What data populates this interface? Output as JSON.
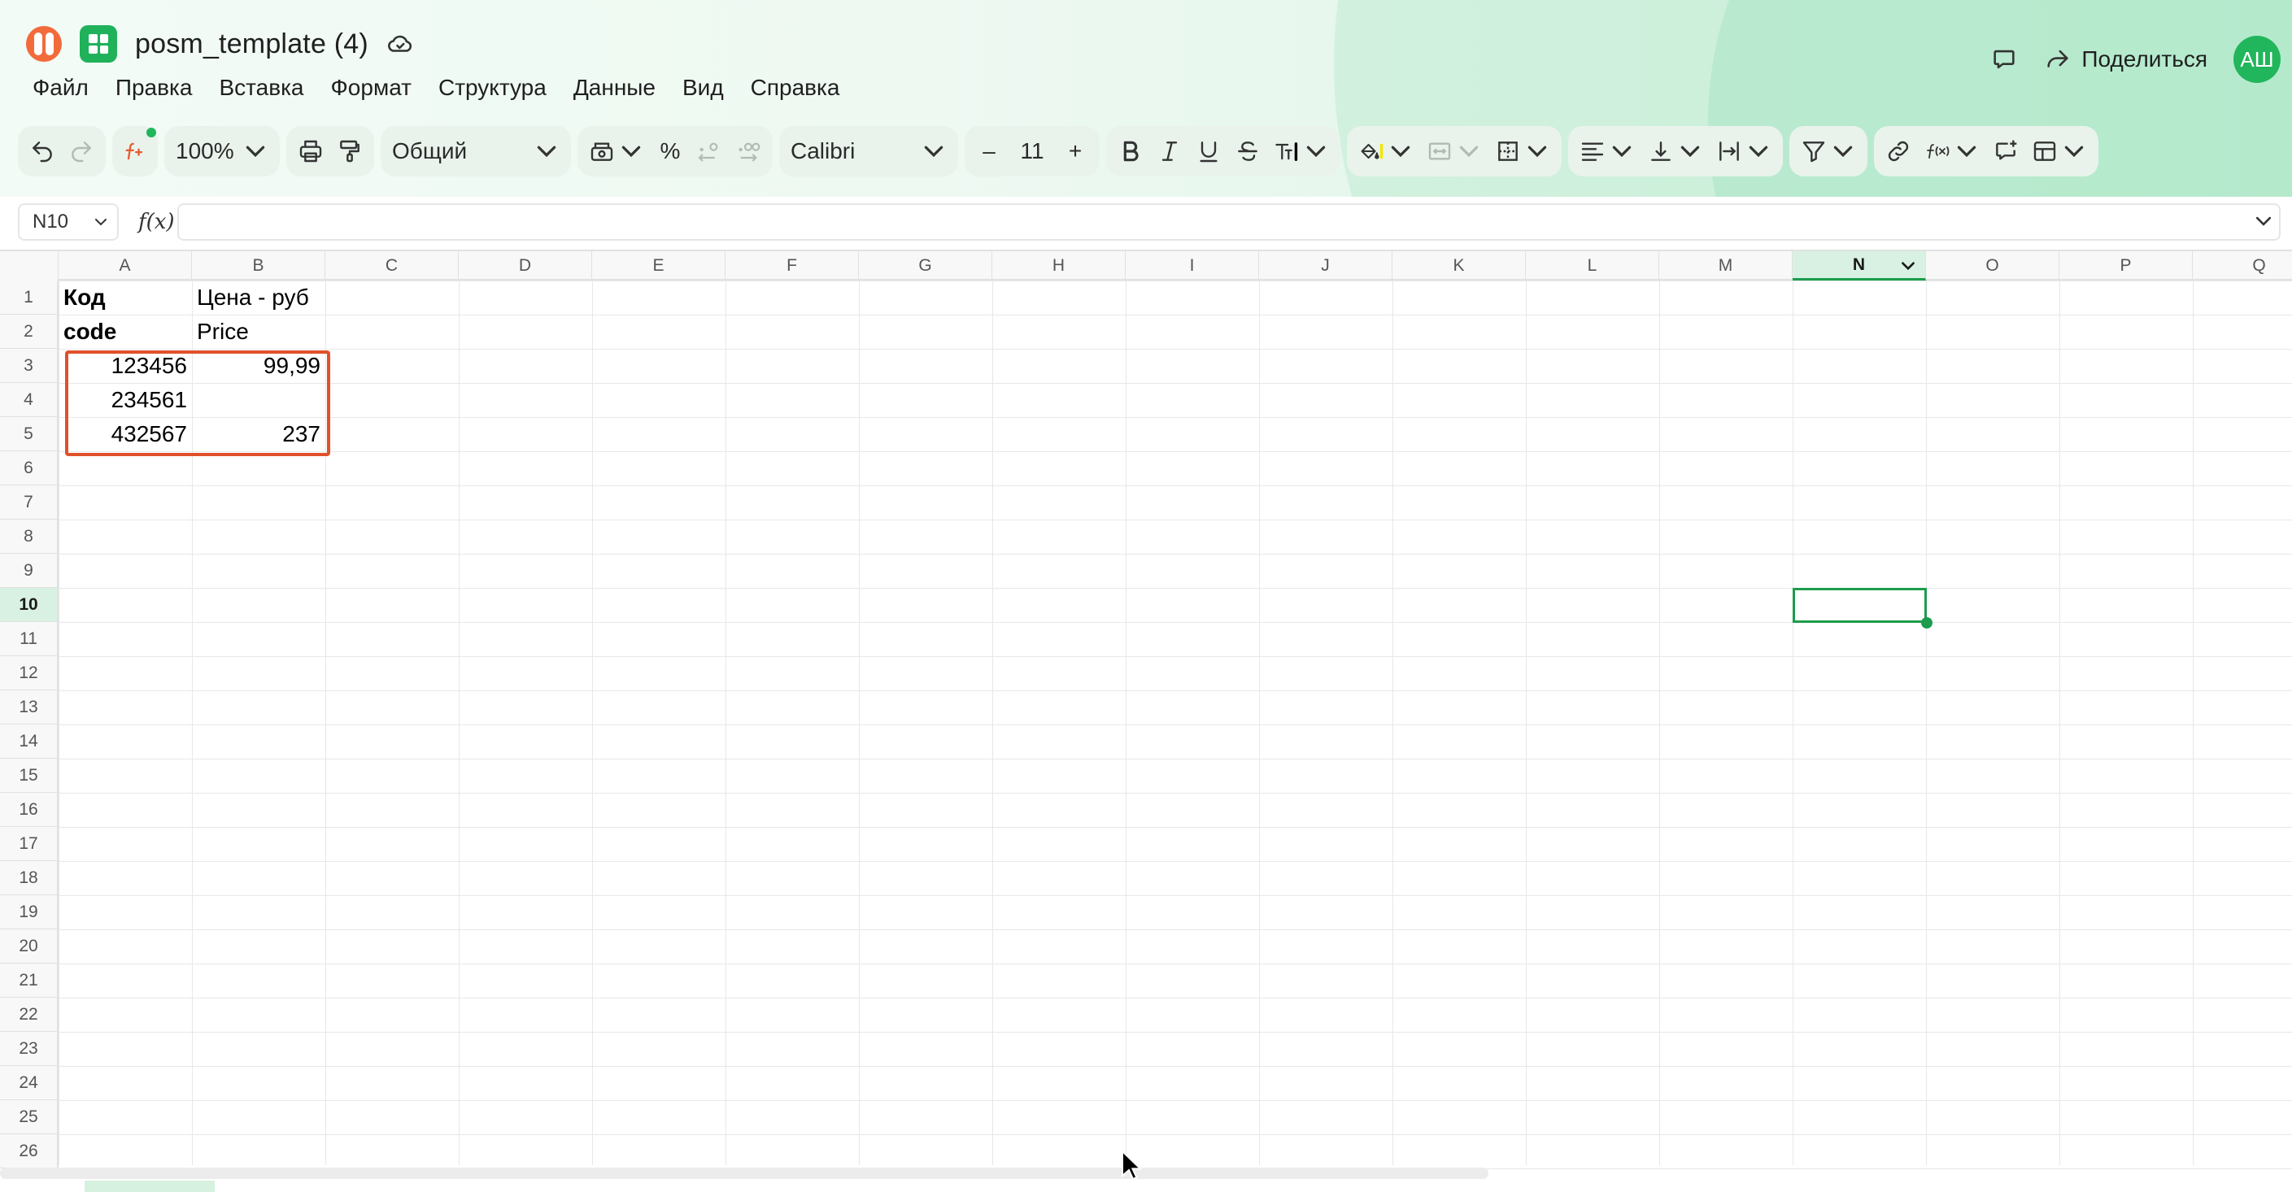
{
  "header": {
    "doc_title": "posm_template (4)",
    "share_label": "Поделиться",
    "avatar_initials": "АШ"
  },
  "menu": [
    "Файл",
    "Правка",
    "Вставка",
    "Формат",
    "Структура",
    "Данные",
    "Вид",
    "Справка"
  ],
  "toolbar": {
    "zoom": "100%",
    "number_format": "Общий",
    "font_name": "Calibri",
    "font_size": "11",
    "percent_symbol": "%",
    "minus_symbol": "–",
    "plus_symbol": "+"
  },
  "formula_bar": {
    "cell_ref": "N10",
    "fx_label": "f(x)",
    "formula": ""
  },
  "grid": {
    "columns": [
      "A",
      "B",
      "C",
      "D",
      "E",
      "F",
      "G",
      "H",
      "I",
      "J",
      "K",
      "L",
      "M",
      "N",
      "O",
      "P",
      "Q"
    ],
    "rows": [
      "1",
      "2",
      "3",
      "4",
      "5",
      "6",
      "7",
      "8",
      "9",
      "10",
      "11",
      "12",
      "13",
      "14",
      "15",
      "16",
      "17",
      "18",
      "19",
      "20",
      "21",
      "22",
      "23",
      "24",
      "25",
      "26"
    ],
    "active_col": "N",
    "active_row": "10",
    "cells": {
      "A1": "Код",
      "B1": "Цена - руб",
      "A2": "code",
      "B2": "Price",
      "A3": "123456",
      "B3": "99,99",
      "A4": "234561",
      "A5": "432567",
      "B5": "237"
    }
  },
  "colors": {
    "accent_green": "#1d9c4d",
    "highlight_red": "#e0512b",
    "brand_orange": "#f26b3a"
  }
}
